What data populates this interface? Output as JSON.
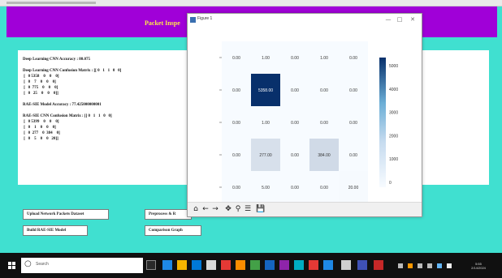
{
  "header": {
    "title": "Packet Inspe"
  },
  "output": {
    "lines": [
      "Deep Learning CNN Accuracy : 80.075",
      "",
      "Deep Learning CNN Confusion Matrix : [[ 0   1   1   0   0]",
      " [   0 5358    0    0    0]",
      " [   0    7    0    0    0]",
      " [   0  775    0    0    0]",
      " [   0   25    0    0    0]]",
      "",
      "RAE-SIE Model Accuracy : 77.425000000001",
      "",
      "RAE-SIE CNN Confusion Matrix : [[ 0   1   1   0   0]",
      " [   0 5399    0    0    0]",
      " [   0    1    0    0    0]",
      " [   0  277    0  384    0]",
      " [   0    5    0    0   20]]"
    ]
  },
  "buttons": {
    "upload": "Upload Network Packets Dataset",
    "preprocess": "Preprocess & R",
    "build": "Build RAE-SIE Model",
    "comparison": "Comparison Graph"
  },
  "figure": {
    "title": "Figure 1",
    "colorbar_ticks": [
      "5000",
      "4000",
      "3000",
      "2000",
      "1000",
      "0"
    ],
    "toolbar_icons": [
      "home-icon",
      "back-icon",
      "forward-icon",
      "pan-icon",
      "zoom-icon",
      "configure-icon",
      "save-icon"
    ]
  },
  "chart_data": {
    "type": "heatmap",
    "rows": 5,
    "cols": 5,
    "values": [
      [
        "0.00",
        "1.00",
        "0.00",
        "1.00",
        "0.00"
      ],
      [
        "0.00",
        "5358.00",
        "0.00",
        "0.00",
        "0.00"
      ],
      [
        "0.00",
        "1.00",
        "0.00",
        "0.00",
        "0.00"
      ],
      [
        "0.00",
        "277.00",
        "0.00",
        "384.00",
        "0.00"
      ],
      [
        "0.00",
        "5.00",
        "0.00",
        "0.00",
        "20.00"
      ]
    ],
    "numeric": [
      [
        0,
        1,
        0,
        1,
        0
      ],
      [
        0,
        5358,
        0,
        0,
        0
      ],
      [
        0,
        1,
        0,
        0,
        0
      ],
      [
        0,
        277,
        0,
        384,
        0
      ],
      [
        0,
        5,
        0,
        0,
        20
      ]
    ],
    "vmax": 5358,
    "colormap": "Blues",
    "colors": {
      "low": "#f7fbff",
      "high": "#08306b"
    }
  },
  "taskbar": {
    "search_placeholder": "Search",
    "clock_time": "5:55",
    "clock_date": "2/14/2024"
  }
}
